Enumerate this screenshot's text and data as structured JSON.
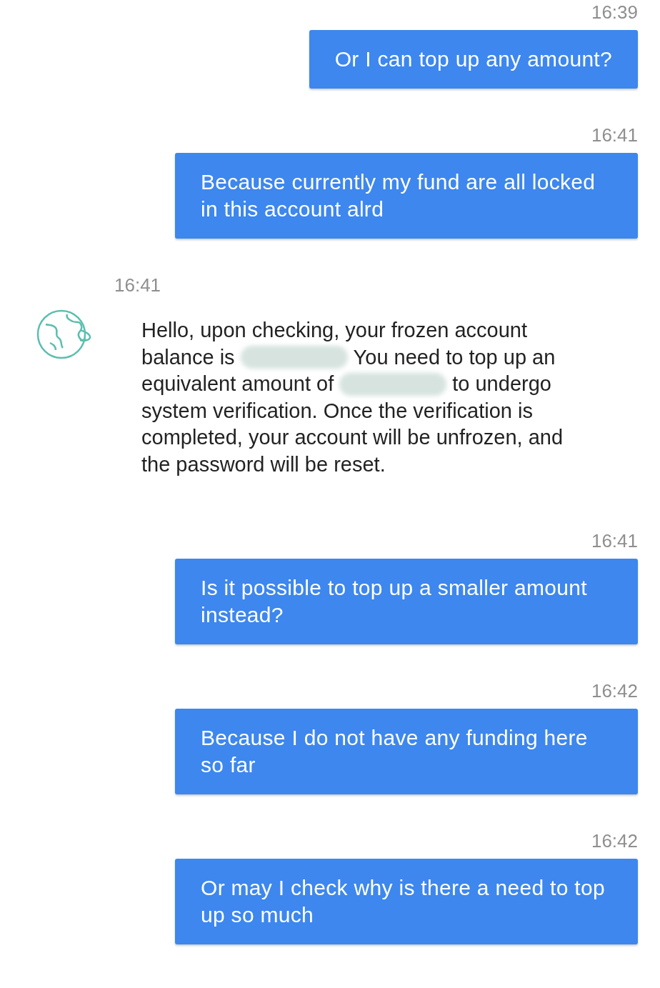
{
  "messages": [
    {
      "kind": "outgoing",
      "time": "16:39",
      "text": "Or I can top up any amount?"
    },
    {
      "kind": "outgoing",
      "time": "16:41",
      "text": "Because currently my fund are all locked in this account alrd"
    },
    {
      "kind": "incoming",
      "time": "16:41",
      "lines": [
        {
          "parts": [
            {
              "kind": "text",
              "text": "Hello, upon checking, your frozen account"
            }
          ]
        },
        {
          "parts": [
            {
              "kind": "text",
              "text": "balance is"
            },
            {
              "kind": "redacted"
            },
            {
              "kind": "text",
              "text": "You need to top up an"
            }
          ]
        },
        {
          "parts": [
            {
              "kind": "text",
              "text": "equivalent amount of"
            },
            {
              "kind": "redacted"
            },
            {
              "kind": "text",
              "text": "to undergo"
            }
          ]
        },
        {
          "parts": [
            {
              "kind": "text",
              "text": "system verification. Once the verification is"
            }
          ]
        },
        {
          "parts": [
            {
              "kind": "text",
              "text": "completed, your account will be unfrozen, and"
            }
          ]
        },
        {
          "parts": [
            {
              "kind": "text",
              "text": "the password will be reset."
            }
          ]
        }
      ]
    },
    {
      "kind": "outgoing",
      "time": "16:41",
      "text": "Is it possible to top up a smaller amount instead?"
    },
    {
      "kind": "outgoing",
      "time": "16:42",
      "text": "Because I do not have any funding here so far"
    },
    {
      "kind": "outgoing",
      "time": "16:42",
      "text": "Or may I check why is there a need to top up so much"
    }
  ]
}
